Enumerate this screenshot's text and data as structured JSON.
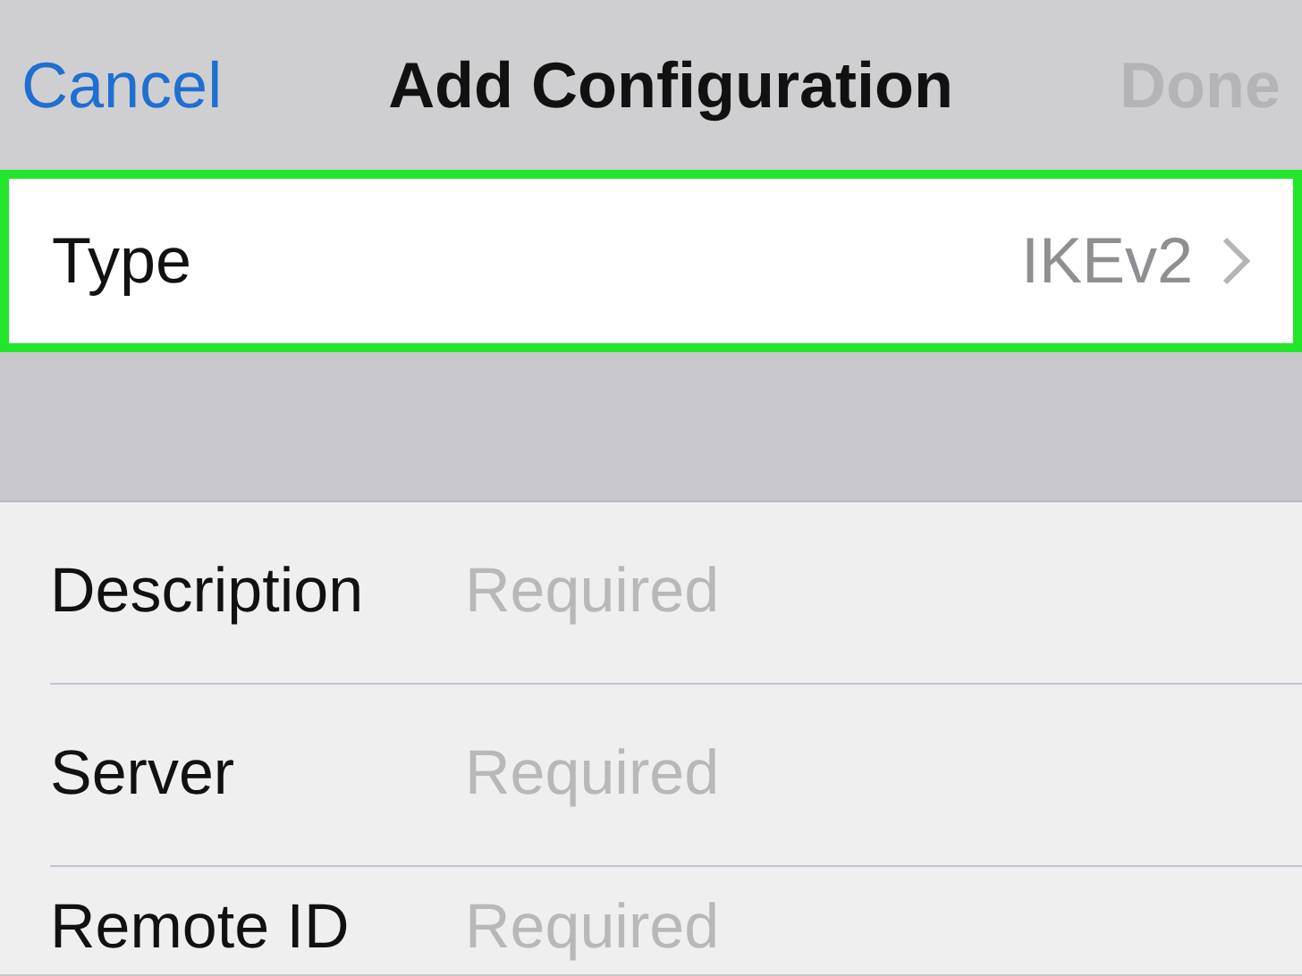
{
  "nav_bar": {
    "cancel": "Cancel",
    "title": "Add Configuration",
    "done": "Done",
    "done_disabled": true
  },
  "type_row": {
    "label": "Type",
    "value": "IKEv2",
    "highlighted": true
  },
  "fields": [
    {
      "label": "Description",
      "placeholder": "Required"
    },
    {
      "label": "Server",
      "placeholder": "Required"
    },
    {
      "label": "Remote ID",
      "placeholder": "Required"
    }
  ]
}
